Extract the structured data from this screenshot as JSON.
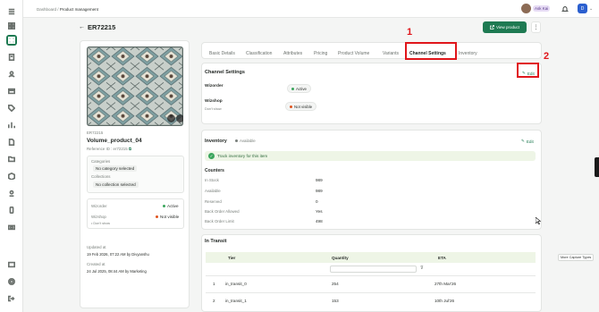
{
  "breadcrumb": {
    "root": "Dashboard",
    "sep": "/",
    "current": "Product management"
  },
  "user": {
    "name": "Ask Kai",
    "initial": "D"
  },
  "header": {
    "sku": "ER72215",
    "view_product": "View product"
  },
  "product": {
    "code": "ER72215",
    "name": "Volume_product_04",
    "ref_label": "Reference ID :",
    "ref_value": "er72215",
    "category_label": "Categories",
    "category_value": "No category selected",
    "collection_label": "Collections",
    "collection_value": "No collection selected",
    "wizorder_label": "Wizorder",
    "wizorder_status": "Active",
    "wizshop_label": "Wizshop",
    "wizshop_status": "Not visible",
    "wizshop_sub": "Don't show",
    "updated_label": "Updated at",
    "updated_value": "19 Feb 2026, 07:22 AM by Divyanshu",
    "created_label": "Created at",
    "created_value": "24 Jul 2025, 08:44 AM by Marketing"
  },
  "tabs": [
    "Basic Details",
    "Classification",
    "Attributes",
    "Pricing",
    "Product Volume",
    "Variants",
    "Channel Settings",
    "Inventory"
  ],
  "channel": {
    "title": "Channel Settings",
    "edit": "Edit",
    "wizorder_label": "Wizorder",
    "wizorder_status": "Active",
    "wizshop_label": "Wizshop",
    "wizshop_sub": "Don't show",
    "wizshop_status": "Not visible"
  },
  "inventory": {
    "title": "Inventory",
    "status": "Available",
    "edit": "Edit",
    "track_text": "Track inventory for this item",
    "counters_title": "Counters",
    "counters": [
      {
        "label": "In Stock",
        "value": "989"
      },
      {
        "label": "Available",
        "value": "989"
      },
      {
        "label": "Reserved",
        "value": "0"
      },
      {
        "label": "Back Order Allowed",
        "value": "Yes"
      },
      {
        "label": "Back Order Limit",
        "value": "498"
      }
    ]
  },
  "transit": {
    "title": "In Transit",
    "headers": [
      "Tier",
      "Quantity",
      "ETA"
    ],
    "rows": [
      {
        "num": "1",
        "tier": "in_transit_0",
        "qty": "254",
        "eta": "27th Mar'26"
      },
      {
        "num": "2",
        "tier": "in_transit_1",
        "qty": "153",
        "eta": "10th Jul'26"
      }
    ]
  },
  "annotations": {
    "one": "1",
    "two": "2"
  },
  "tooltip": "More Capture Types",
  "colors": {
    "brand": "#1e7a52",
    "annotation": "#e0161b",
    "active": "#3aa55c",
    "inactive": "#e0531d"
  }
}
